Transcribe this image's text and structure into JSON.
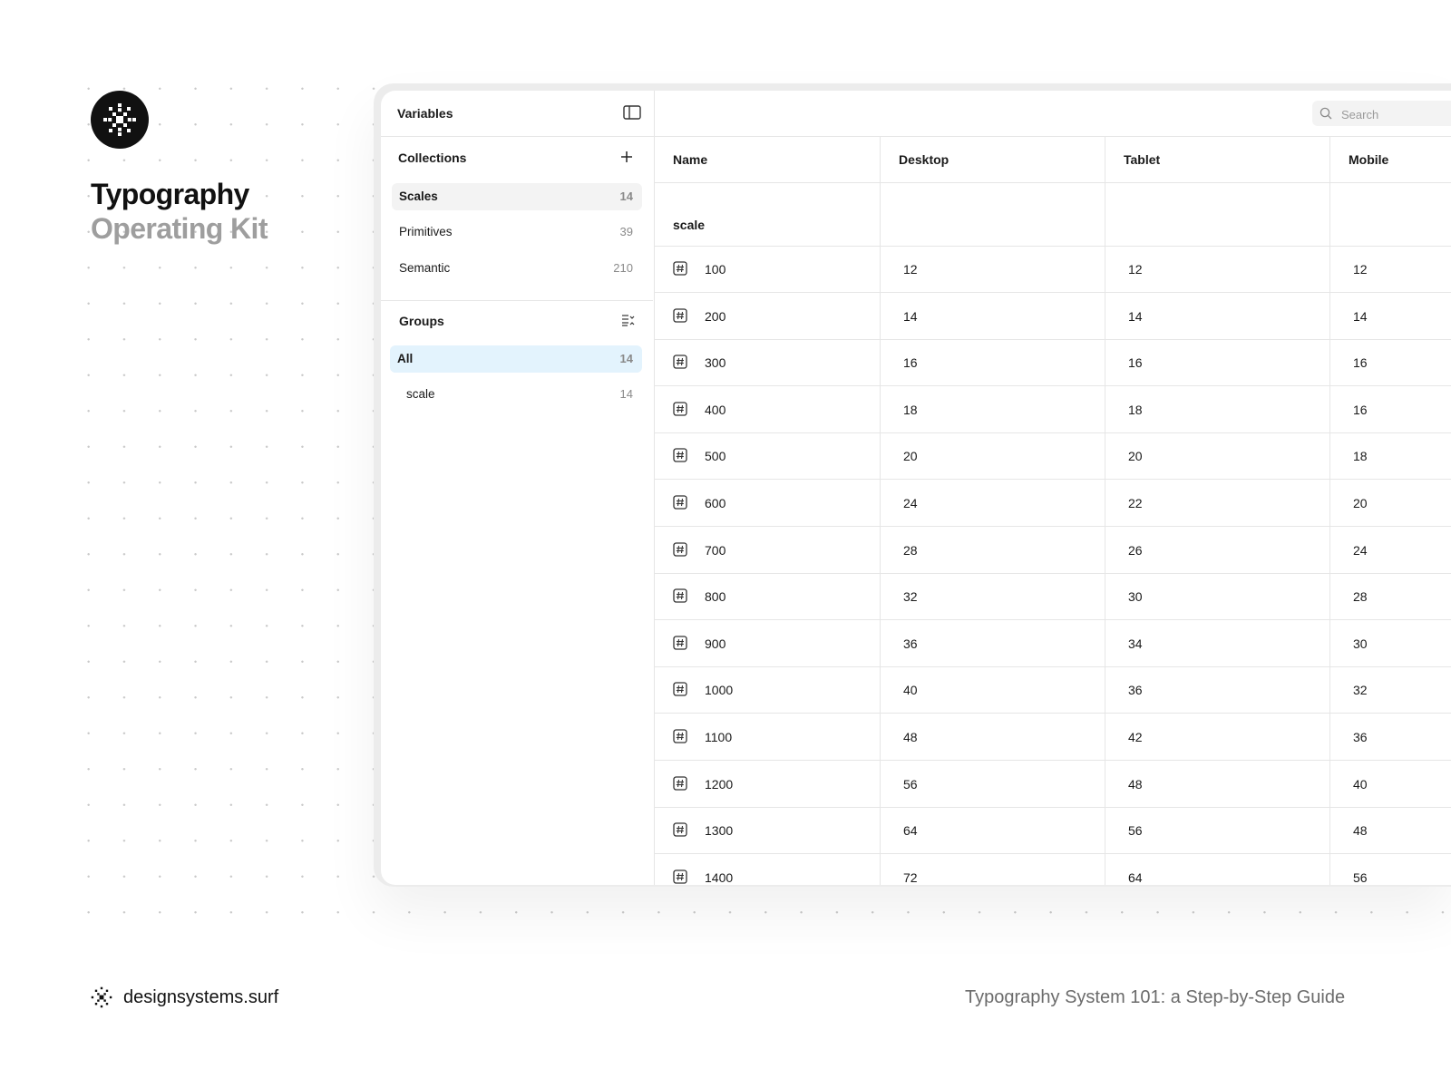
{
  "brand": {
    "title_line1": "Typography",
    "title_line2": "Operating Kit",
    "site": "designsystems.surf",
    "guide": "Typography System 101: a Step-by-Step Guide"
  },
  "sidebar": {
    "header": "Variables",
    "collections_title": "Collections",
    "collections": [
      {
        "label": "Scales",
        "count": "14"
      },
      {
        "label": "Primitives",
        "count": "39"
      },
      {
        "label": "Semantic",
        "count": "210"
      }
    ],
    "groups_title": "Groups",
    "groups": [
      {
        "label": "All",
        "count": "14"
      },
      {
        "label": "scale",
        "count": "14"
      }
    ]
  },
  "search": {
    "placeholder": "Search"
  },
  "table": {
    "columns": [
      "Name",
      "Desktop",
      "Tablet",
      "Mobile"
    ],
    "group_label": "scale",
    "rows": [
      [
        "100",
        "12",
        "12",
        "12"
      ],
      [
        "200",
        "14",
        "14",
        "14"
      ],
      [
        "300",
        "16",
        "16",
        "16"
      ],
      [
        "400",
        "18",
        "18",
        "16"
      ],
      [
        "500",
        "20",
        "20",
        "18"
      ],
      [
        "600",
        "24",
        "22",
        "20"
      ],
      [
        "700",
        "28",
        "26",
        "24"
      ],
      [
        "800",
        "32",
        "30",
        "28"
      ],
      [
        "900",
        "36",
        "34",
        "30"
      ],
      [
        "1000",
        "40",
        "36",
        "32"
      ],
      [
        "1100",
        "48",
        "42",
        "36"
      ],
      [
        "1200",
        "56",
        "48",
        "40"
      ],
      [
        "1300",
        "64",
        "56",
        "48"
      ],
      [
        "1400",
        "72",
        "64",
        "56"
      ]
    ]
  },
  "icons": {
    "logo": "pixel-asterisk-icon",
    "panel": "sidebar-toggle-icon",
    "add": "plus-icon",
    "groups": "sort-list-icon",
    "search": "search-icon",
    "variable": "number-variable-icon"
  },
  "colors": {
    "accent_selected": "#e3f3fd",
    "selected_gray": "#f3f3f3",
    "subtitle_gray": "#9e9e9e"
  }
}
